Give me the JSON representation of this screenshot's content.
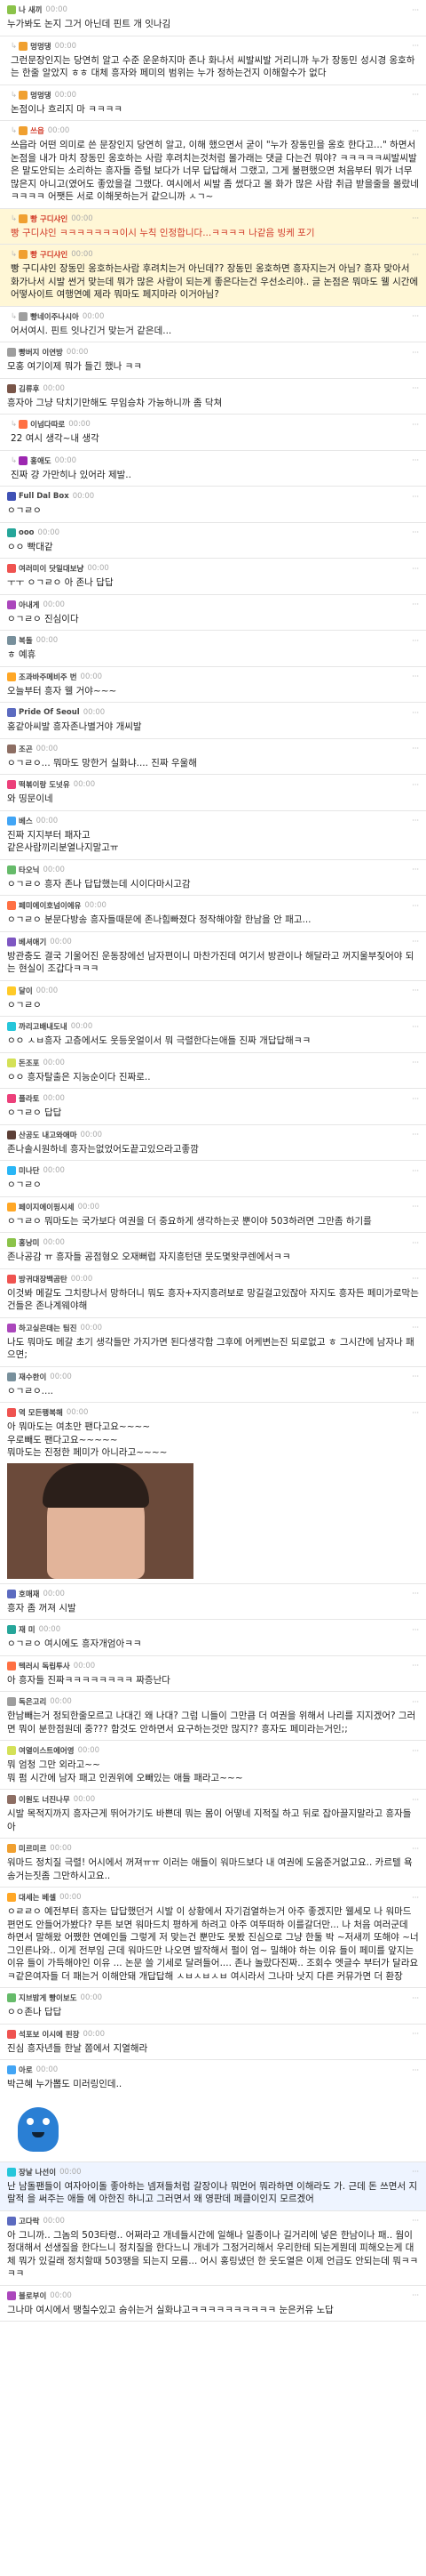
{
  "colors": {
    "nick_highlight": "#d23c2a",
    "highlight_bg": "#fff7d6",
    "highlight_blue_bg": "#eef4ff"
  },
  "comments": [
    {
      "nick": "나 새끼",
      "time": "00:00",
      "text": "누가봐도 논지 그거 아닌데 핀트 개 잇나김",
      "color": "#8bc34a"
    },
    {
      "nick": "멍멍댕",
      "time": "00:00",
      "text": "그런문장인지는 당연히 알고 수준 운운하지마 존나 화나서 씨발씨발 거리니까 누가 장동민 성시경 옹호하는 한줄 알았지 ㅎㅎ 대체 흥자와 페미의 범위는 누가 정하는건지 이해할수가 없다",
      "color": "#f0a030",
      "reply": true
    },
    {
      "nick": "멍멍댕",
      "time": "00:00",
      "text": "논점이나 흐리지 마 ㅋㅋㅋㅋ",
      "color": "#f0a030",
      "reply": true
    },
    {
      "nick": "쓰읍",
      "time": "00:00",
      "text": "쓰읍라 어떤 의미로 쓴 문장인지 당연히 알고, 이해 했으면서 굳이 \"누가 장동민을 옹호 한다고...\" 하면서 논점을 내가 마치 장동민 옹호하는 사람 후려치는것처럼 몰가래는 댓글 다는건 뭐야? ㅋㅋㅋㅋㅋ씨발씨발은 말도안되는 소리하는 흥자들 증털 보다가 너무 답답해서 그랬고, 그게 불편했으면 처음부터 뭐가 너무 많은지 아니고(였어도 좋았을걸 그랬다. 여시에서 씨발 좀 썼다고 몰 화가 많은 사람 취급 받을줄을 몰랐네ㅋㅋㅋㅋ 어쨋든 서로 이해못하는거 같으니까 ㅅㄱ~",
      "color": "#f0a030",
      "reply": true,
      "redNick": true
    },
    {
      "nick": "빵 구디샤인",
      "time": "00:00",
      "text": "빵 구디샤인 ㅋㅋㅋㅋㅋㅋㅋ이시 누칙 인정합니다...ㅋㅋㅋㅋ 나같음 빙케 포기",
      "color": "#f0a030",
      "reply": true,
      "redNick": true,
      "redText": true,
      "hl": "hl"
    },
    {
      "nick": "빵 구디샤인",
      "time": "00:00",
      "text": "빵 구디샤인 장동민 옹호하는사람 후려치는거 아닌데?? 장동민 옹호하면 흥자지는거 아님? 흥자 맞아서 화가나서 시발 썬거 맞는데 뭐가 많은 사람이 되는게 좋은다는건 우선소리야.. 글 논점은 뭐마도 웰 시간에 어떻사이트 여행연예 제라 뭐마도 페지마라 이거아님?",
      "color": "#f0a030",
      "reply": true,
      "redNick": true,
      "hl": "hl"
    },
    {
      "nick": "빵네이주나시아",
      "time": "00:00",
      "text": "어서여시. 핀트 잇나긴거 맞는거 같은데...",
      "color": "#9e9e9e",
      "reply": true
    },
    {
      "nick": "빵버지 이연방",
      "time": "00:00",
      "text": "모홍 여기이제 뭐가 들긴 했나 ㅋㅋ",
      "color": "#9e9e9e"
    },
    {
      "nick": "김류후",
      "time": "00:00",
      "text": "흥자아 그냥 닥치기만해도 무임승차 가능하니까 좀 닥쳐",
      "color": "#795548"
    },
    {
      "nick": "이넘다따로",
      "time": "00:00",
      "text": "22 여시 생각~내 생각",
      "color": "#ff7043",
      "reply": true
    },
    {
      "nick": "홍애도",
      "time": "00:00",
      "text": "진짜 걍 가만히나 있어라 제발..",
      "color": "#9c27b0",
      "reply": true
    },
    {
      "nick": "Full Dal Box",
      "time": "00:00",
      "text": "ㅇㄱㄹㅇ",
      "color": "#3f51b5"
    },
    {
      "nick": "ooo",
      "time": "00:00",
      "text": "ㅇㅇ 빡대같",
      "color": "#26a69a"
    },
    {
      "nick": "여러미이 닷일대보냥",
      "time": "00:00",
      "text": "ㅜㅜ ㅇㄱㄹㅇ 아 존나 답답",
      "color": "#ef5350"
    },
    {
      "nick": "아내게",
      "time": "00:00",
      "text": "ㅇㄱㄹㅇ 진심이다",
      "color": "#ab47bc"
    },
    {
      "nick": "복돌",
      "time": "00:00",
      "text": "ㅎ 예휴",
      "color": "#78909c"
    },
    {
      "nick": "조과바주메비주 번",
      "time": "00:00",
      "text": "오늘부터 흥자 웰 거야~~~",
      "color": "#ffa726"
    },
    {
      "nick": "Pride Of Seoul",
      "time": "00:00",
      "text": "홍같아씨발 흥자존나별거야 개씨발",
      "color": "#5c6bc0"
    },
    {
      "nick": "조곤",
      "time": "00:00",
      "text": "ㅇㄱㄹㅇ... 뭐마도 망한거 실화냐.... 진짜 우울해",
      "color": "#8d6e63"
    },
    {
      "nick": "떡볶이랑 도넛유",
      "time": "00:00",
      "text": "와 띵문이네",
      "color": "#ec407a"
    },
    {
      "nick": "베스",
      "time": "00:00",
      "text": "진짜 지지부터 패자고\n같은사람끼리분열나지말고ㅠ",
      "color": "#42a5f5"
    },
    {
      "nick": "타오닉",
      "time": "00:00",
      "text": "ㅇㄱㄹㅇ 흥자 존나 답답했는데 시이다마시고감",
      "color": "#66bb6a"
    },
    {
      "nick": "페미에이호넘이에유",
      "time": "00:00",
      "text": "ㅇㄱㄹㅇ 분문다방송 흥자들때문에 존나힘빠졌다 정작해야할 한남을 안 패고...",
      "color": "#ff7043"
    },
    {
      "nick": "베셔애기",
      "time": "00:00",
      "text": "방관충도 결국 기울어진 운동장에선 남자편이니 마찬가진데 여기서 방관이나 해달라고 꺼지울부짖어야 되는 현실이 조갑다ㅋㅋㅋ",
      "color": "#7e57c2"
    },
    {
      "nick": "달이",
      "time": "00:00",
      "text": "ㅇㄱㄹㅇ",
      "color": "#ffca28"
    },
    {
      "nick": "까리고배내도내",
      "time": "00:00",
      "text": "ㅇㅇ ㅅㅂ흥자 고층에서도 웃등웃얼이서 뭐 극렬한다는애들 진짜 개답답해ㅋㅋ",
      "color": "#26c6da"
    },
    {
      "nick": "돈조포",
      "time": "00:00",
      "text": "ㅇㅇ 흥자탈출은 지능순이다 진짜로..",
      "color": "#d4e157"
    },
    {
      "nick": "플라토",
      "time": "00:00",
      "text": "ㅇㄱㄹㅇ 답답",
      "color": "#ec407a"
    },
    {
      "nick": "산공도 내고와애마",
      "time": "00:00",
      "text": "존나솔시원하네 흥자는없었어도끝고있으라고좋깜",
      "color": "#5d4037"
    },
    {
      "nick": "미나단",
      "time": "00:00",
      "text": "ㅇㄱㄹㅇ",
      "color": "#29b6f6"
    },
    {
      "nick": "페이지에이핑시세",
      "time": "00:00",
      "text": "ㅇㄱㄹㅇ 뭐마도는 국가보다 여권을 더 중요하게 생각하는곳 뿐이야 503하려면 그만좀 하기를",
      "color": "#ffa726"
    },
    {
      "nick": "홍낭미",
      "time": "00:00",
      "text": "존나공감 ㅠ 흥자들 공점형오 오재뻐럽 자지흥턴댄 뭇도몇왓쿠렌에서ㅋㅋ",
      "color": "#8bc34a"
    },
    {
      "nick": "방귀대장백곰탄",
      "time": "00:00",
      "text": "이것봐 메갈도 그치랑나서 망하더니 뭐도 흥자+자지흥려보로 망길걸고있잖아 자지도 흥자든 페미가로막는건들은 존나계웨야해",
      "color": "#ef5350"
    },
    {
      "nick": "하고싶은데는 팀진",
      "time": "00:00",
      "text": "나도 뭐마도 메갈 초기 생각들만 가지가면 된다생각함 그후에 어케변는진 되로없고 ㅎ 그시간에 남자나 패으면;",
      "color": "#ab47bc"
    },
    {
      "nick": "재수한이",
      "time": "00:00",
      "text": "ㅇㄱㄹㅇ....",
      "color": "#78909c"
    },
    {
      "nick": "역 모든행복해",
      "time": "00:00",
      "text": "아 뭐마도는 여초만 팬다고요~~~~\n우로빼도 팬다고요~~~~~\n뭐마도는 진정한 페미가 아니라고~~~~",
      "color": "#ef5350",
      "image": true,
      "imageCaption": ""
    },
    {
      "nick": "호매재",
      "time": "00:00",
      "text": "흥자 좀 꺼져 시발",
      "color": "#5c6bc0"
    },
    {
      "nick": "재 미",
      "time": "00:00",
      "text": "ㅇㄱㄹㅇ 여시에도 흥자개엄아ㅋㅋ",
      "color": "#26a69a"
    },
    {
      "nick": "텍러시 독립투사",
      "time": "00:00",
      "text": "아 흥자들 진짜ㅋㅋㅋㅋㅋㅋㅋㅋ 짜증난다",
      "color": "#ff7043"
    },
    {
      "nick": "독은고리",
      "time": "00:00",
      "text": "한남빼는거 정되한줄모르고 나대긴 왜 나대? 그럼 니들이 그만큼 더 여권을 위해서 나리를 지지겠어? 그러면 뭐이 분한점원데 중??? 함것도 안하면서 요구하는것만 많지?? 흥자도 페미라는거인;;",
      "color": "#9e9e9e"
    },
    {
      "nick": "여열이스트에어영",
      "time": "00:00",
      "text": "뭐 엄청 그만 외라고~~\n뭐 펌 시간에 남자 패고 인권위에 오빼있는 애들 패라고~~~",
      "color": "#d4e157"
    },
    {
      "nick": "이원도 너진나무",
      "time": "00:00",
      "text": "시발 목적지까지 흥자근게 뛰어가기도 바쁜데 뭐는 몸이 어떻네 지적질 하고 뒤로 잡아끌지말라고 흥자들아",
      "color": "#8d6e63"
    },
    {
      "nick": "미르미르",
      "time": "00:00",
      "text": "워마드 정치질 극렬! 어시에서 꺼져ㅠㅠ 이러는 애들이 워마드보다 내 여권에 도움준거없고요.. 카르텔 욕송거는짓좀 그만하시고요..",
      "color": "#f0a030"
    },
    {
      "nick": "대세는 베셀",
      "time": "00:00",
      "text": "ㅇㄹㄹㅇ 예전부터 흥자는 답답했던거 시발 이 상황에서 자기검열하는거 아주 좋겠지만 웰세모 나 워마드 편먼도 안들어가봤다? 무튼 보면 워마드치 평하게 하려고 아주 여뚜떠하 이를갈더만... 나 처음 여러군데 하면서 말해왔 어쨌한 연예인들 그렇게 저 맞는건 뿐만도 못봤 진심으로 그냥 한둘 박 ~저새끼 또해야 ~너그인른나와.. 이게 전부임 근데 워마드만 나오면 발작해서 펄이 엄~ 밀해야 하는 이유 들이 페미를 앞지는 이유 들이 가득해야인 이유 ... 논문 쓸 기세로 달려들어.... 존나 놀랐다진짜.. 조회수 엣글수 부터가 달라요 ㅋ같은여자들 더 패는거 이해안돼 개답답해 ㅅㅂㅅㅂㅅㅂ 여시라서 그나마 낫지 다른 커뮤가면 더 환장",
      "color": "#ffa726"
    },
    {
      "nick": "지브밤게 빵이보도",
      "time": "00:00",
      "text": "ㅇㅇ존나 답답",
      "color": "#66bb6a"
    },
    {
      "nick": "석포보 이시에 핀장",
      "time": "00:00",
      "text": "진심 흥자년들 한날 쫌에서 지열해라",
      "color": "#ef5350"
    },
    {
      "nick": "아로",
      "time": "00:00",
      "text": "박근혜 누가뽑도 미러링인데..",
      "color": "#42a5f5",
      "emoticon": true
    },
    {
      "nick": "장날 나선이",
      "time": "00:00",
      "text": "난 남돌팬들이 여자아이돌 좋아하는 넴져들처럼 갈장이나 뭐먼어 뭐라하면 이해라도 가. 근데 돈 쓰면서 지랄적 을 써주는 애들 에 아한진 하니고 그러면서 왜 영판데 페클이인지 모르겠어",
      "color": "#26c6da",
      "hl": "hlb"
    },
    {
      "nick": "고다락",
      "time": "00:00",
      "text": "아 그니까.. 그놈의 503타령.. 어쩌라고 개네들시간에 일해나 일종이나 길거리에 넣은 한남이나 패.. 웜이 정대해서 선생질을 한다느니 정치질을 한다느니 개네가 그정거리해서 우리한테 되는게뭔데 피해오는게 대체 뭐가 있길래 정치할때 503땡을 되는지 모름... 어시 홍링냈던 한 웃도열은 이제 언급도 안되는데 뭐ㅋㅋㅋㅋ",
      "color": "#5c6bc0"
    },
    {
      "nick": "블로부이",
      "time": "00:00",
      "text": "그나마 여시에서 땡칠수있고 숨쉬는거 실화냐고ㅋㅋㅋㅋㅋㅋㅋㅋㅋㅋ 눈은커유 노답",
      "color": "#ab47bc"
    }
  ]
}
